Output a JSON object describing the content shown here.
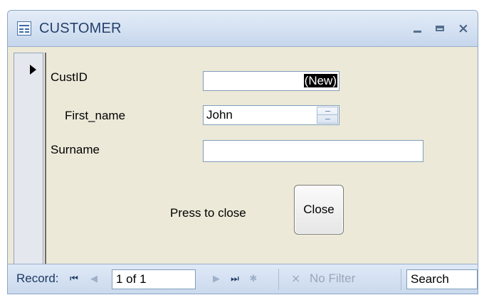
{
  "window": {
    "title": "CUSTOMER",
    "icon": "form-icon",
    "controls": {
      "minimize": "minimize-icon",
      "maximize": "maximize-icon",
      "close": "×"
    }
  },
  "form": {
    "fields": {
      "cust_id": {
        "label": "CustID",
        "value": "(New)"
      },
      "first_name": {
        "label": "First_name",
        "value": "John"
      },
      "surname": {
        "label": "Surname",
        "value": ""
      }
    },
    "close_prompt": "Press to close",
    "close_button_label": "Close"
  },
  "navigation": {
    "label": "Record:",
    "first_icon": "⏮",
    "prev_icon": "◀",
    "current": "1 of 1",
    "next_icon": "▶",
    "last_icon": "⏭",
    "new_icon": "✱",
    "filter_label": "No Filter",
    "search_placeholder": "Search"
  },
  "colors": {
    "form_background": "#ece9d8",
    "titlebar": "#d4e1f2",
    "accent": "#25416b"
  }
}
